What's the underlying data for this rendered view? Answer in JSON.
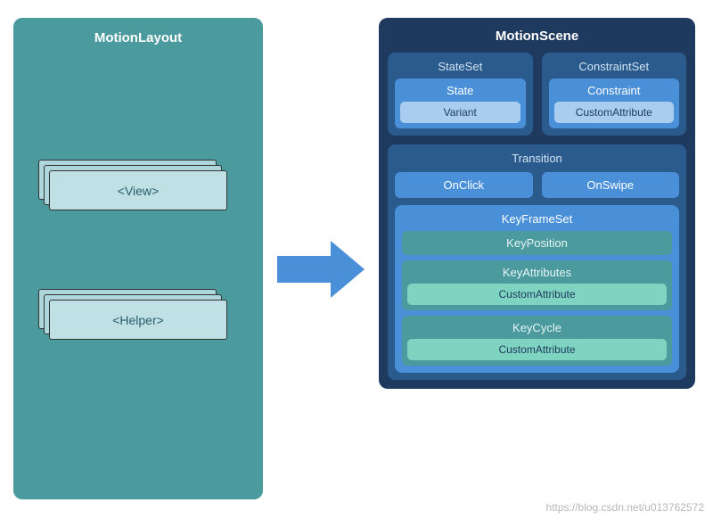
{
  "left": {
    "title": "MotionLayout",
    "view_label": "<View>",
    "helper_label": "<Helper>"
  },
  "right": {
    "title": "MotionScene",
    "stateset": {
      "title": "StateSet",
      "state": "State",
      "variant": "Variant"
    },
    "constraintset": {
      "title": "ConstraintSet",
      "constraint": "Constraint",
      "custom_attr": "CustomAttribute"
    },
    "transition": {
      "title": "Transition",
      "onclick": "OnClick",
      "onswipe": "OnSwipe",
      "keyframeset": {
        "title": "KeyFrameSet",
        "keyposition": "KeyPosition",
        "keyattributes": {
          "title": "KeyAttributes",
          "custom_attr": "CustomAttribute"
        },
        "keycycle": {
          "title": "KeyCycle",
          "custom_attr": "CustomAttribute"
        }
      }
    }
  },
  "watermark": "https://blog.csdn.net/u013762572"
}
